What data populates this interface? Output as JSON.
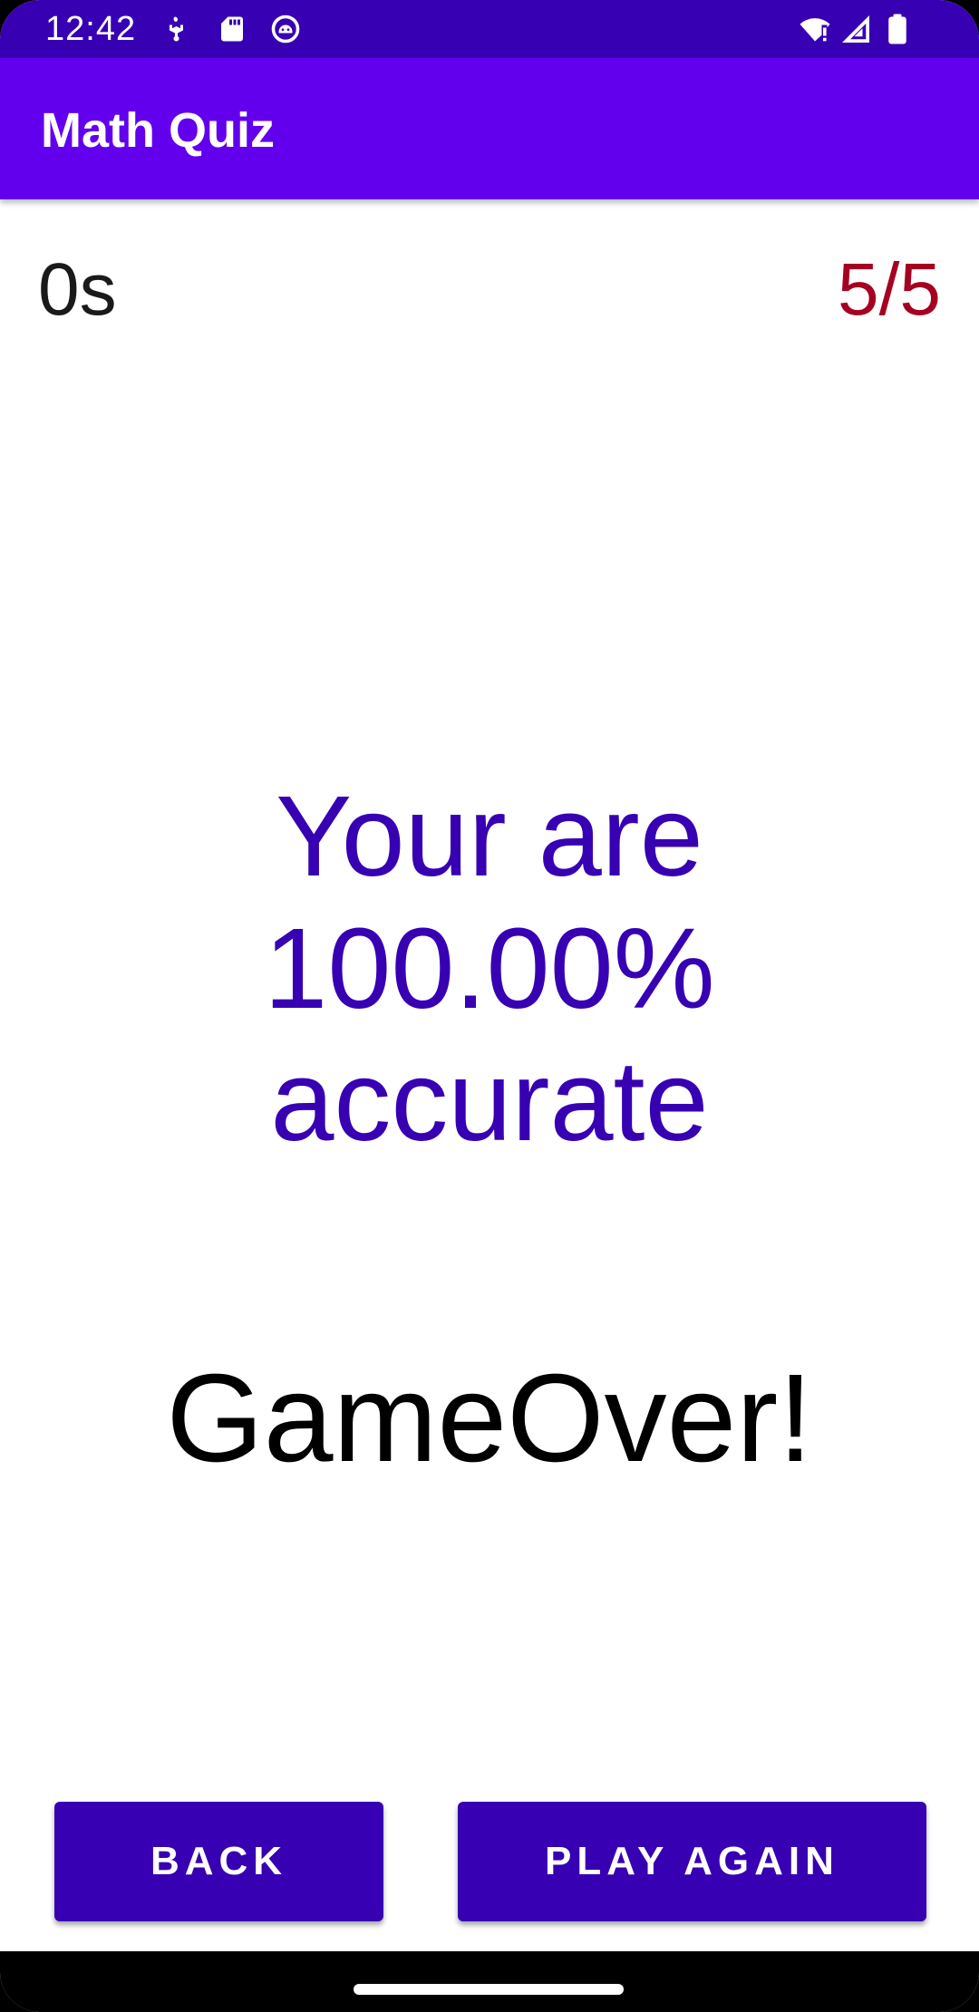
{
  "status_bar": {
    "time": "12:42",
    "left_icons": [
      "usb-debug-icon",
      "sd-card-icon",
      "android-robot-icon"
    ],
    "right_icons": [
      "wifi-alert-icon",
      "cell-signal-icon",
      "battery-icon"
    ]
  },
  "app_bar": {
    "title": "Math Quiz"
  },
  "quiz": {
    "timer": "0s",
    "score": "5/5",
    "result": "Your are 100.00% accurate",
    "game_over": "GameOver!"
  },
  "buttons": {
    "back_label": "BACK",
    "play_again_label": "PLAY AGAIN"
  },
  "colors": {
    "status_bar": "#3700B3",
    "app_bar": "#6200EE",
    "accent": "#3700B3",
    "score": "#A50021"
  }
}
